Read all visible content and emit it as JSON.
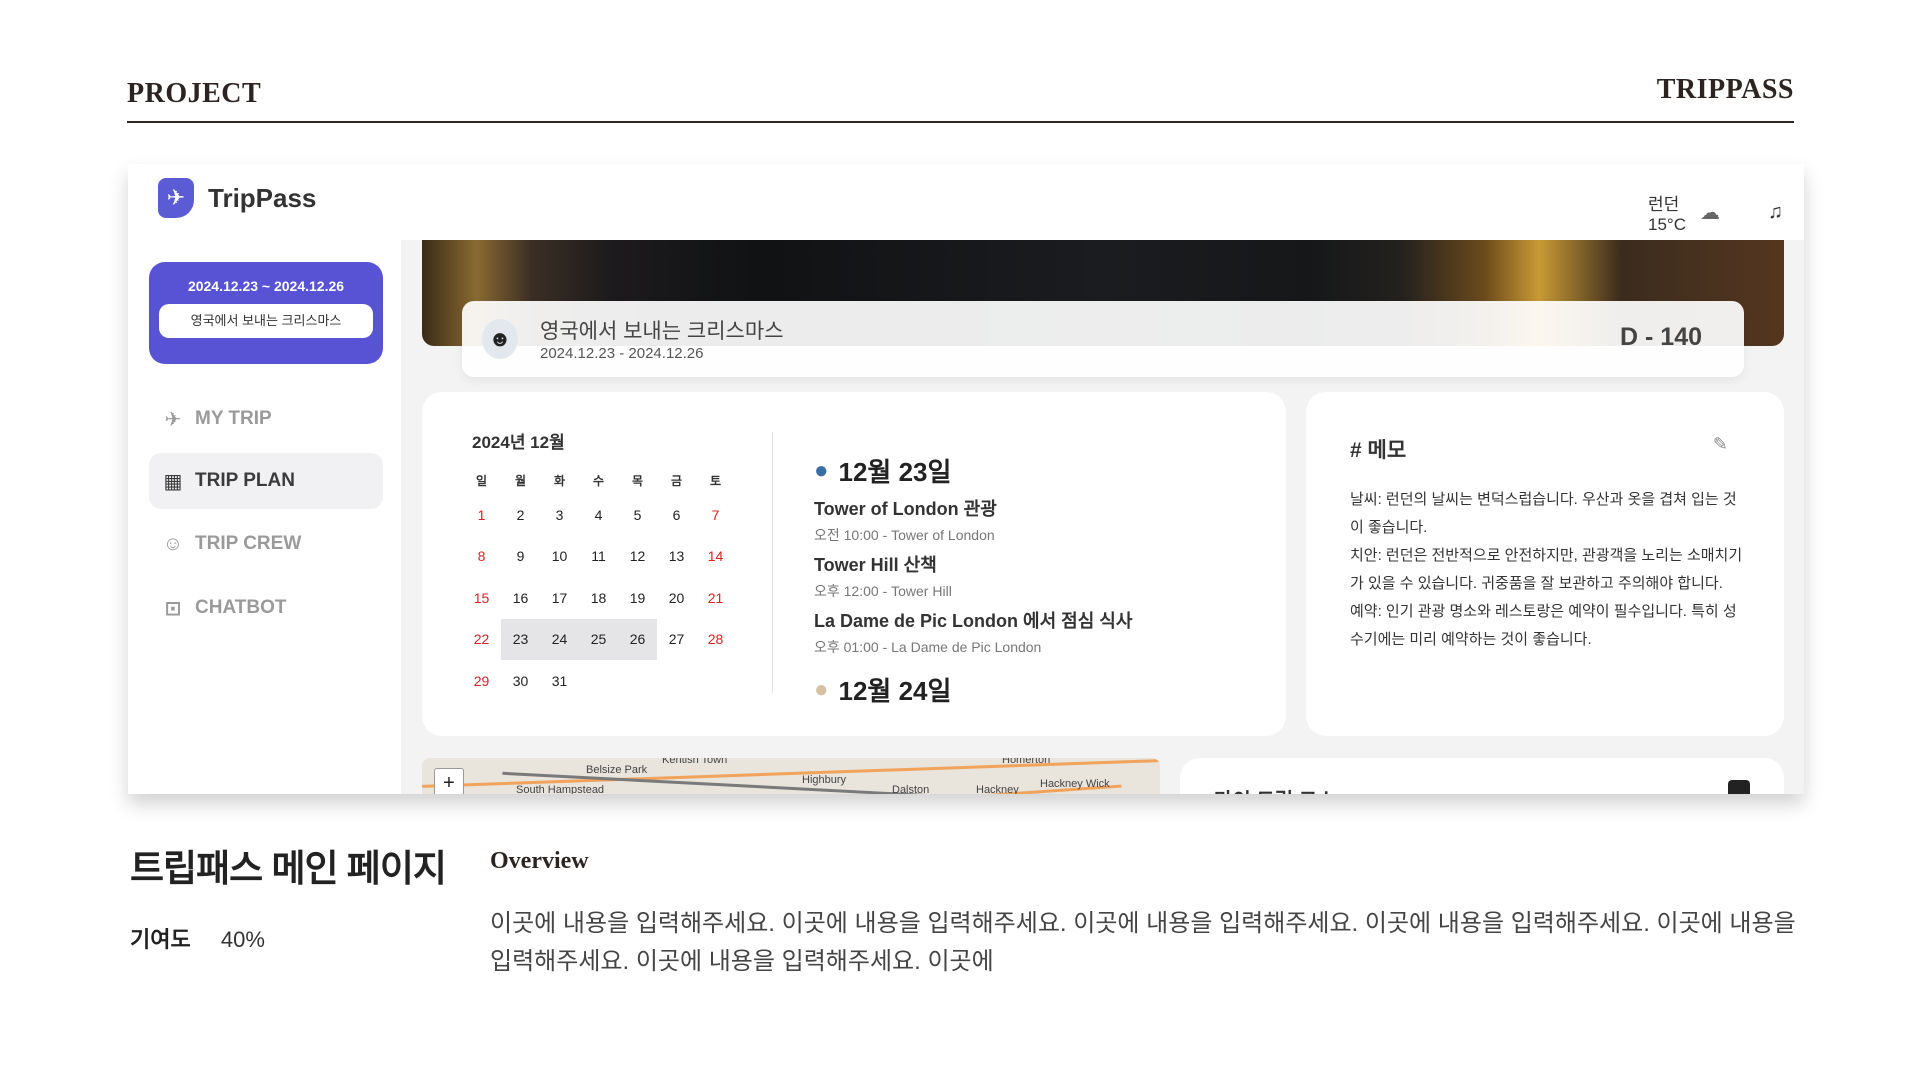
{
  "header": {
    "left": "PROJECT",
    "right": "TRIPPASS"
  },
  "app": {
    "logo_text": "TripPass",
    "trip_card": {
      "dates": "2024.12.23 ~ 2024.12.26",
      "name": "영국에서 보내는 크리스마스"
    },
    "nav": [
      {
        "label": "MY TRIP",
        "icon": "airplane-icon"
      },
      {
        "label": "TRIP PLAN",
        "icon": "calendar-icon"
      },
      {
        "label": "TRIP CREW",
        "icon": "smile-icon"
      },
      {
        "label": "CHATBOT",
        "icon": "robot-icon"
      }
    ],
    "topbar": {
      "weather": "런던 15°C"
    },
    "banner": {
      "title": "영국에서 보내는 크리스마스",
      "dates": "2024.12.23 - 2024.12.26",
      "dday": "D - 140"
    },
    "calendar": {
      "month": "2024년 12월",
      "weekdays": [
        "일",
        "월",
        "화",
        "수",
        "목",
        "금",
        "토"
      ],
      "weeks": [
        [
          "1",
          "2",
          "3",
          "4",
          "5",
          "6",
          "7"
        ],
        [
          "8",
          "9",
          "10",
          "11",
          "12",
          "13",
          "14"
        ],
        [
          "15",
          "16",
          "17",
          "18",
          "19",
          "20",
          "21"
        ],
        [
          "22",
          "23",
          "24",
          "25",
          "26",
          "27",
          "28"
        ],
        [
          "29",
          "30",
          "31",
          "",
          "",
          "",
          ""
        ]
      ],
      "selected": [
        "23",
        "24",
        "25",
        "26"
      ]
    },
    "schedule": {
      "day1": "12월 23일",
      "events": [
        {
          "title": "Tower of London 관광",
          "sub": "오전 10:00 - Tower of London"
        },
        {
          "title": "Tower Hill 산책",
          "sub": "오후 12:00 - Tower Hill"
        },
        {
          "title": "La Dame de Pic London 에서 점심 식사",
          "sub": "오후 01:00 - La Dame de Pic London"
        }
      ],
      "day2": "12월 24일"
    },
    "memo": {
      "title": "# 메모",
      "lines": [
        "날씨: 런던의 날씨는 변덕스럽습니다. 우산과 옷을 겹쳐 입는 것이 좋습니다.",
        "치안: 런던은 전반적으로 안전하지만, 관광객을 노리는 소매치기가 있을 수 있습니다. 귀중품을 잘 보관하고 주의해야 합니다.",
        "예약: 인기 관광 명소와 레스토랑은 예약이 필수입니다. 특히 성수기에는 미리 예약하는 것이 좋습니다."
      ]
    },
    "map": {
      "zoom": "+",
      "labels": [
        "Belsize Park",
        "Highbury",
        "South Hampstead",
        "Dalston",
        "Hackney",
        "Hackney Wick",
        "Kentish Town",
        "Homerton"
      ]
    },
    "course_title": "마이 트립 코스"
  },
  "project": {
    "title": "트립패스 메인 페이지",
    "contrib_label": "기여도",
    "contrib_value": "40%",
    "overview_label": "Overview",
    "overview_text": "이곳에 내용을 입력해주세요. 이곳에 내용을 입력해주세요. 이곳에 내용을 입력해주세요. 이곳에 내용을 입력해주세요. 이곳에 내용을 입력해주세요. 이곳에 내용을 입력해주세요. 이곳에"
  }
}
